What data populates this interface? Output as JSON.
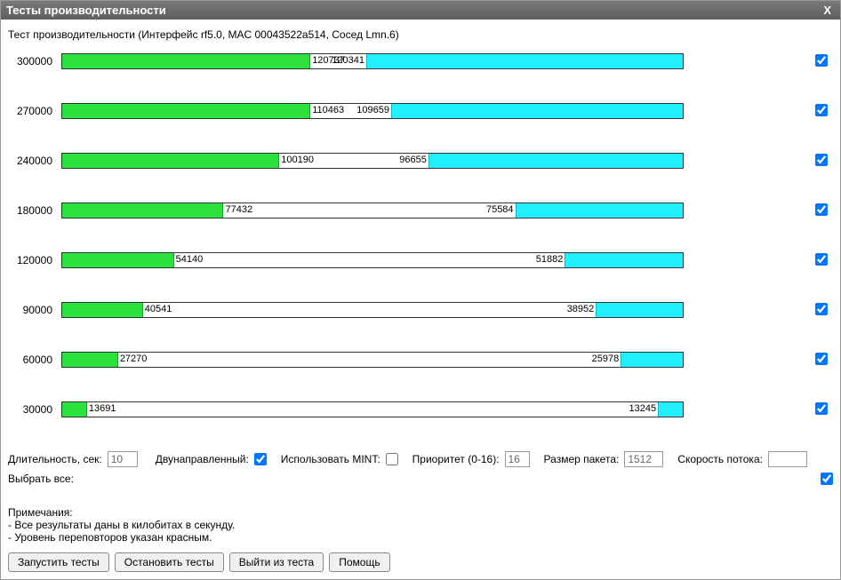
{
  "title": "Тесты производительности",
  "close": "X",
  "subtitle": "Тест производительности (Интерфейс rf5.0, MAC 00043522a514, Сосед Lmn.6)",
  "rows": [
    {
      "label": "300000",
      "greenPct": 40,
      "cyanStart": 49,
      "val1": "120737",
      "val2": "120341",
      "checked": true
    },
    {
      "label": "270000",
      "greenPct": 40,
      "cyanStart": 53,
      "val1": "110463",
      "val2": "109659",
      "checked": true
    },
    {
      "label": "240000",
      "greenPct": 35,
      "cyanStart": 59,
      "val1": "100190",
      "val2": "96655",
      "checked": true
    },
    {
      "label": "180000",
      "greenPct": 26,
      "cyanStart": 73,
      "val1": "77432",
      "val2": "75584",
      "checked": true
    },
    {
      "label": "120000",
      "greenPct": 18,
      "cyanStart": 81,
      "val1": "54140",
      "val2": "51882",
      "checked": true
    },
    {
      "label": "90000",
      "greenPct": 13,
      "cyanStart": 86,
      "val1": "40541",
      "val2": "38952",
      "checked": true
    },
    {
      "label": "60000",
      "greenPct": 9,
      "cyanStart": 90,
      "val1": "27270",
      "val2": "25978",
      "checked": true
    },
    {
      "label": "30000",
      "greenPct": 4,
      "cyanStart": 96,
      "val1": "13691",
      "val2": "13245",
      "checked": true
    }
  ],
  "controls": {
    "duration_label": "Длительность, сек:",
    "duration_value": "10",
    "bidir_label": "Двунаправленный:",
    "bidir_checked": true,
    "mint_label": "Использовать MINT:",
    "mint_checked": false,
    "priority_label": "Приоритет (0-16):",
    "priority_value": "16",
    "packet_label": "Размер пакета:",
    "packet_value": "1512",
    "speed_label": "Скорость потока:",
    "speed_value": "",
    "selectall_label": "Выбрать все:",
    "selectall_checked": true
  },
  "notes": {
    "heading": "Примечания:",
    "l1": "- Все результаты даны в килобитах в секунду.",
    "l2": "- Уровень переповторов указан красным."
  },
  "buttons": {
    "run": "Запустить тесты",
    "stop": "Остановить тесты",
    "exit": "Выйти из теста",
    "help": "Помощь"
  }
}
